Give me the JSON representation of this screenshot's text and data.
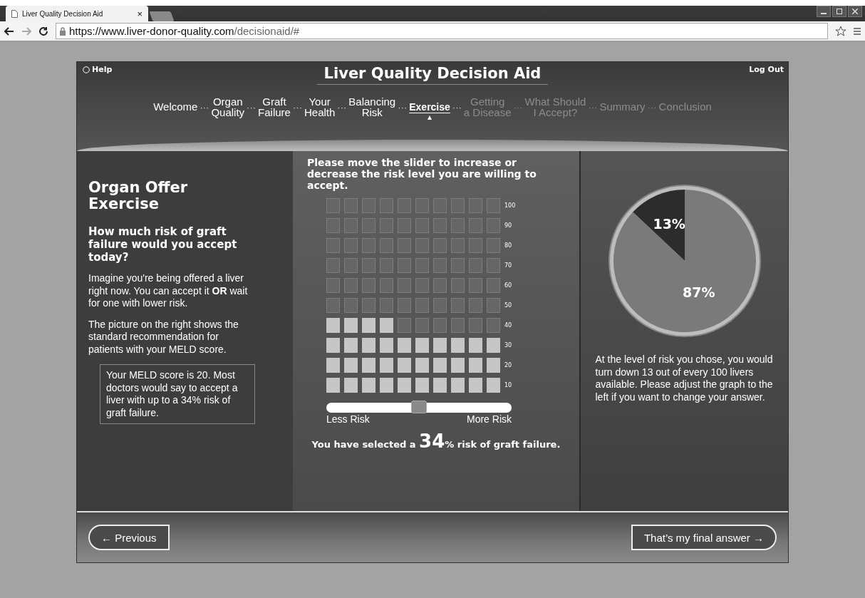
{
  "browser": {
    "tab_title": "Liver Quality Decision Aid",
    "tab_close": "×",
    "url_host": "https://www.liver-donor-quality.com",
    "url_path": "/decisionaid/#"
  },
  "header": {
    "help": "Help",
    "title": "Liver Quality Decision Aid",
    "logout": "Log Out"
  },
  "nav": [
    {
      "kind": "step",
      "label": "Welcome",
      "selected": false,
      "disabled": false
    },
    {
      "kind": "separator",
      "label": "···"
    },
    {
      "kind": "step",
      "label": "Organ\nQuality",
      "selected": false,
      "disabled": false
    },
    {
      "kind": "separator",
      "label": "···"
    },
    {
      "kind": "step",
      "label": "Graft\nFailure",
      "selected": false,
      "disabled": false
    },
    {
      "kind": "separator",
      "label": "···"
    },
    {
      "kind": "step",
      "label": "Your\nHealth",
      "selected": false,
      "disabled": false
    },
    {
      "kind": "separator",
      "label": "···"
    },
    {
      "kind": "step",
      "label": "Balancing\nRisk",
      "selected": false,
      "disabled": false
    },
    {
      "kind": "separator",
      "label": "···"
    },
    {
      "kind": "step",
      "label": "Exercise",
      "selected": true,
      "disabled": false
    },
    {
      "kind": "separator",
      "label": "···"
    },
    {
      "kind": "step",
      "label": "Getting\na Disease",
      "selected": false,
      "disabled": true
    },
    {
      "kind": "separator",
      "label": "···"
    },
    {
      "kind": "step",
      "label": "What Should\nI Accept?",
      "selected": false,
      "disabled": true
    },
    {
      "kind": "separator",
      "label": "···"
    },
    {
      "kind": "step",
      "label": "Summary",
      "selected": false,
      "disabled": true
    },
    {
      "kind": "separator",
      "label": "···"
    },
    {
      "kind": "step",
      "label": "Conclusion",
      "selected": false,
      "disabled": true
    }
  ],
  "left": {
    "title": "Organ Offer Exercise",
    "question": "How much risk of graft failure would you accept today?",
    "paragraphs": [
      "Imagine you're being offered a liver right now. You can accept it **OR** wait for one with lower risk.",
      "The picture on the right shows the standard recommendation for patients with your MELD score."
    ],
    "note": "Your MELD score is 20. Most doctors would say to accept a liver with up to a 34% risk of graft failure."
  },
  "middle": {
    "instruction": "Please move the slider to increase or decrease the risk level you are willing to accept.",
    "grid": [
      {
        "label": "100",
        "cells": [
          false,
          false,
          false,
          false,
          false,
          false,
          false,
          false,
          false,
          false
        ]
      },
      {
        "label": "90",
        "cells": [
          false,
          false,
          false,
          false,
          false,
          false,
          false,
          false,
          false,
          false
        ]
      },
      {
        "label": "80",
        "cells": [
          false,
          false,
          false,
          false,
          false,
          false,
          false,
          false,
          false,
          false
        ]
      },
      {
        "label": "70",
        "cells": [
          false,
          false,
          false,
          false,
          false,
          false,
          false,
          false,
          false,
          false
        ]
      },
      {
        "label": "60",
        "cells": [
          false,
          false,
          false,
          false,
          false,
          false,
          false,
          false,
          false,
          false
        ]
      },
      {
        "label": "50",
        "cells": [
          false,
          false,
          false,
          false,
          false,
          false,
          false,
          false,
          false,
          false
        ]
      },
      {
        "label": "40",
        "cells": [
          true,
          true,
          true,
          true,
          false,
          false,
          false,
          false,
          false,
          false
        ]
      },
      {
        "label": "30",
        "cells": [
          true,
          true,
          true,
          true,
          true,
          true,
          true,
          true,
          true,
          true
        ]
      },
      {
        "label": "20",
        "cells": [
          true,
          true,
          true,
          true,
          true,
          true,
          true,
          true,
          true,
          true
        ]
      },
      {
        "label": "10",
        "cells": [
          true,
          true,
          true,
          true,
          true,
          true,
          true,
          true,
          true,
          true
        ]
      }
    ],
    "slider": {
      "level": 0.5,
      "min_label": "Less Risk",
      "max_label": "More Risk"
    },
    "result": "You have selected a **34**% risk of graft failure."
  },
  "right": {
    "chart_data": {
      "type": "pie",
      "values": [
        13,
        87
      ],
      "value_labels": [
        "13%",
        "87%"
      ],
      "data_labels": true
    },
    "text": "At the level of risk you chose, you would turn down 13 out of every 100 livers available. Please adjust the graph to the left if you want to change your answer."
  },
  "footer": {
    "previous": "← Previous",
    "next": "That’s my final answer →"
  }
}
